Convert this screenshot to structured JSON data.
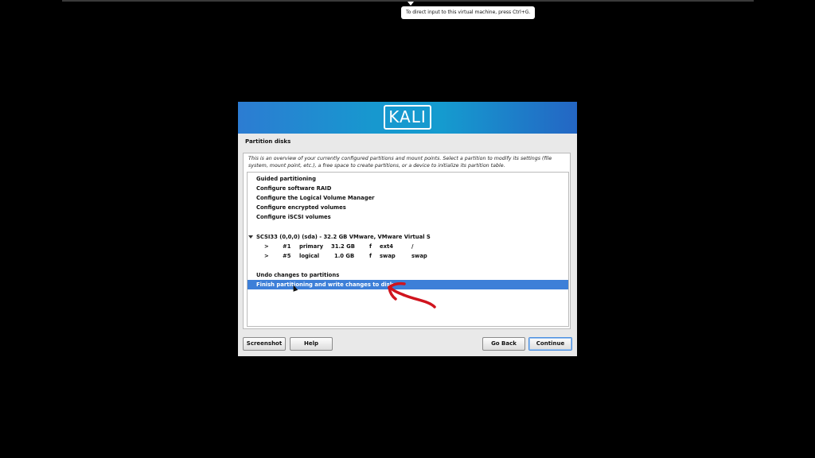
{
  "tooltip": "To direct input to this virtual machine, press Ctrl+G.",
  "installer": {
    "logo_text": "KALI",
    "page_title": "Partition disks",
    "description": "This is an overview of your currently configured partitions and mount points. Select a partition to modify its settings (file system, mount point, etc.), a free space to create partitions, or a device to initialize its partition table.",
    "menu": [
      "Guided partitioning",
      "Configure software RAID",
      "Configure the Logical Volume Manager",
      "Configure encrypted volumes",
      "Configure iSCSI volumes"
    ],
    "disk": "SCSI33 (0,0,0) (sda) - 32.2 GB VMware, VMware Virtual S",
    "partitions": [
      {
        "arrow": ">",
        "num": "#1",
        "type": "primary",
        "size": "31.2 GB",
        "flag": "f",
        "fs": "ext4",
        "mount": "/"
      },
      {
        "arrow": ">",
        "num": "#5",
        "type": "logical",
        "size": "1.0 GB",
        "flag": "f",
        "fs": "swap",
        "mount": "swap"
      }
    ],
    "undo": "Undo changes to partitions",
    "finish": "Finish partitioning and write changes to disk",
    "buttons": {
      "screenshot": "Screenshot",
      "help": "Help",
      "go_back": "Go Back",
      "continue": "Continue"
    }
  },
  "colors": {
    "selection": "#3d7fd8",
    "annotation_arrow": "#d0141e",
    "banner": "#1798cf"
  }
}
